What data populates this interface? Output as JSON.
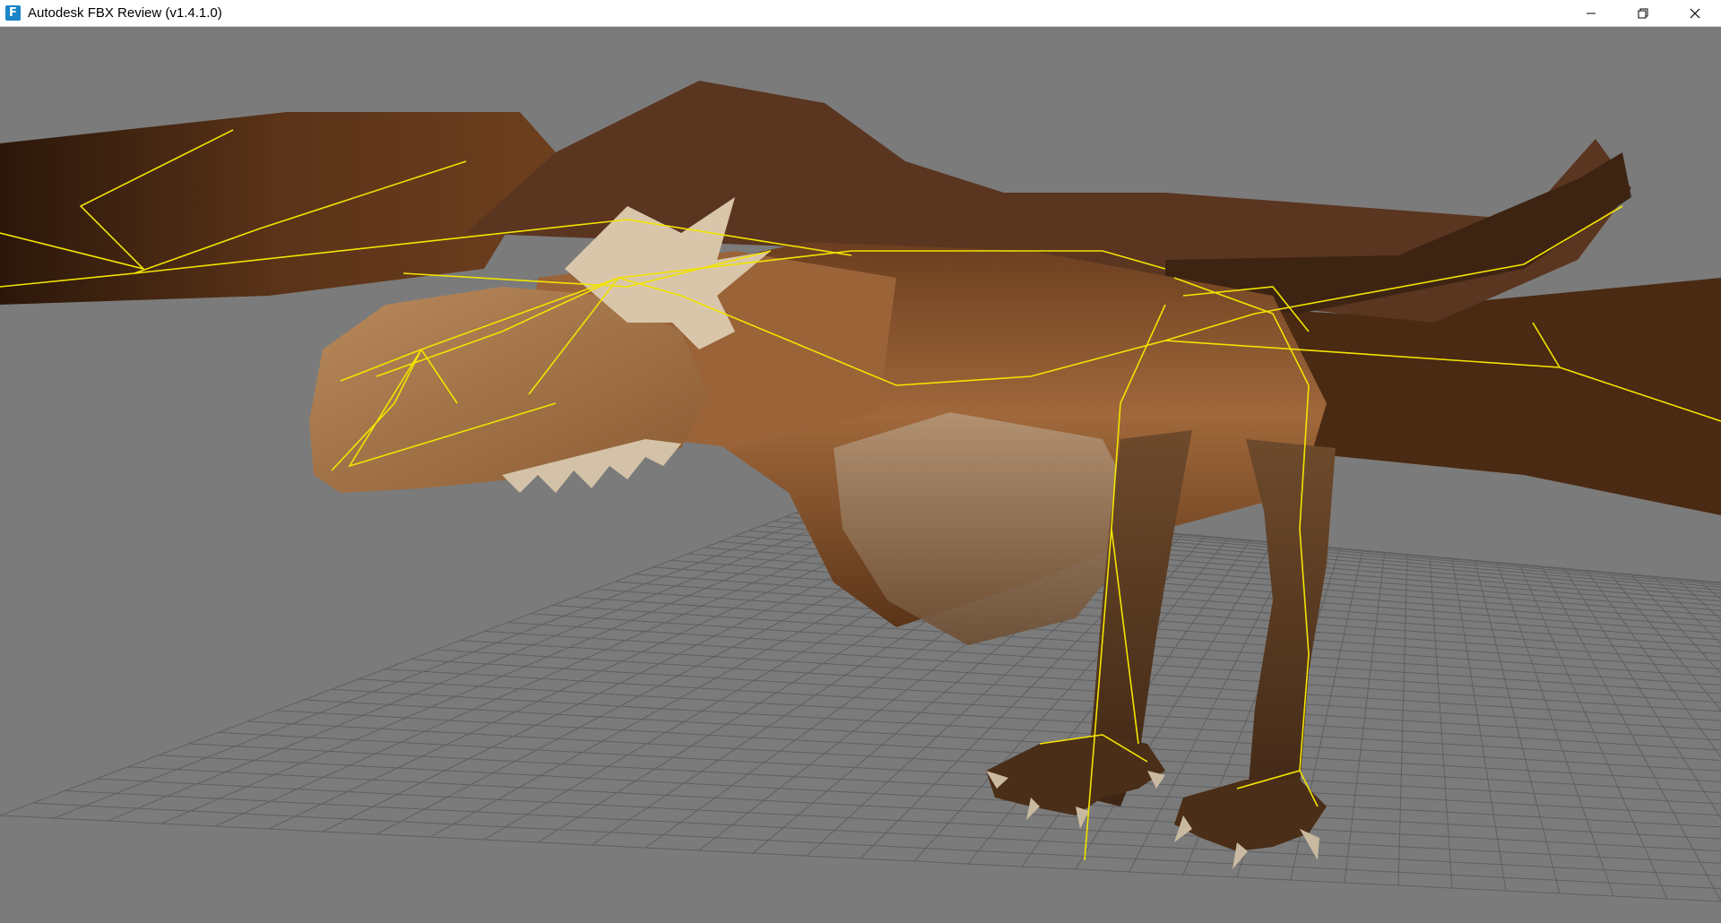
{
  "window": {
    "title": "Autodesk FBX Review (v1.4.1.0)",
    "app_icon_letter": "F",
    "controls": {
      "minimize_icon": "minimize-icon",
      "maximize_icon": "restore-icon",
      "close_icon": "close-icon"
    }
  },
  "viewport": {
    "background_color": "#7b7b7b",
    "grid_color": "#5f5f5f",
    "skeleton_color": "#f2e400",
    "model": "dragon"
  }
}
